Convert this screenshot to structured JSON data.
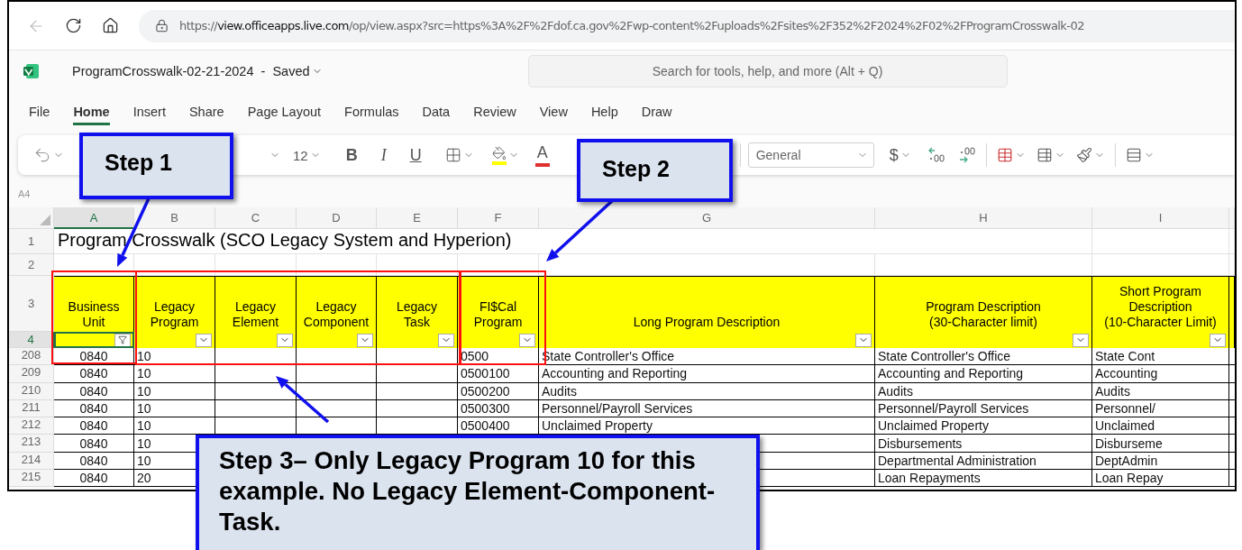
{
  "browser": {
    "url": "https://**view.officeapps.live.com**/op/view.aspx?src=https%3A%2F%2Fdof.ca.gov%2Fwp-content%2Fuploads%2Fsites%2F352%2F2024%2F02%2FProgramCrosswalk-02"
  },
  "app": {
    "document_title": "ProgramCrosswalk-02-21-2024  -  Saved",
    "search_placeholder": "Search for tools, help, and more (Alt + Q)"
  },
  "menu": [
    {
      "label": "File",
      "selected": false
    },
    {
      "label": "Home",
      "selected": true
    },
    {
      "label": "Insert",
      "selected": false
    },
    {
      "label": "Share",
      "selected": false
    },
    {
      "label": "Page Layout",
      "selected": false
    },
    {
      "label": "Formulas",
      "selected": false
    },
    {
      "label": "Data",
      "selected": false
    },
    {
      "label": "Review",
      "selected": false
    },
    {
      "label": "View",
      "selected": false
    },
    {
      "label": "Help",
      "selected": false
    },
    {
      "label": "Draw",
      "selected": false
    }
  ],
  "toolbar": {
    "font_size": "12",
    "format_buttons": [
      {
        "label": "B",
        "kind": "bold"
      },
      {
        "label": "I",
        "kind": "italic"
      },
      {
        "label": "U",
        "kind": "underline"
      }
    ],
    "font_color_label": "A",
    "number_format": "General",
    "currency_label": "$"
  },
  "name_box": "A4",
  "sheet": {
    "columns": [
      {
        "label": "A",
        "selected": true
      },
      {
        "label": "B",
        "selected": false
      },
      {
        "label": "C",
        "selected": false
      },
      {
        "label": "D",
        "selected": false
      },
      {
        "label": "E",
        "selected": false
      },
      {
        "label": "F",
        "selected": false
      },
      {
        "label": "G",
        "selected": false
      },
      {
        "label": "H",
        "selected": false
      },
      {
        "label": "I",
        "selected": false
      }
    ],
    "title_row": "1",
    "title": "Program Crosswalk (SCO Legacy System and Hyperion)",
    "blank_row": "2",
    "header_row": "3",
    "headers": [
      "Business\nUnit",
      "Legacy\nProgram",
      "Legacy\nElement",
      "Legacy\nComponent",
      "Legacy\nTask",
      "FI$Cal\nProgram",
      "Long Program Description",
      "Program Description\n(30-Character limit)",
      "Short Program\nDescription\n(10-Character Limit)"
    ],
    "filter_row": {
      "number": "4",
      "selected": true
    },
    "rows": [
      {
        "number": "208",
        "a": "0840",
        "b": "10",
        "f": "0500",
        "g": "State Controller's Office",
        "h": "State Controller's Office",
        "i": "State Cont"
      },
      {
        "number": "209",
        "a": "0840",
        "b": "10",
        "f": "0500100",
        "g": "Accounting and Reporting",
        "h": "Accounting and Reporting",
        "i": "Accounting"
      },
      {
        "number": "210",
        "a": "0840",
        "b": "10",
        "f": "0500200",
        "g": "Audits",
        "h": "Audits",
        "i": "Audits"
      },
      {
        "number": "211",
        "a": "0840",
        "b": "10",
        "f": "0500300",
        "g": "Personnel/Payroll Services",
        "h": "Personnel/Payroll Services",
        "i": "Personnel/"
      },
      {
        "number": "212",
        "a": "0840",
        "b": "10",
        "f": "0500400",
        "g": "Unclaimed Property",
        "h": "Unclaimed Property",
        "i": "Unclaimed"
      },
      {
        "number": "213",
        "a": "0840",
        "b": "10",
        "h": "Disbursements",
        "i": "Disburseme"
      },
      {
        "number": "214",
        "a": "0840",
        "b": "10",
        "h": "Departmental Administration",
        "i": "DeptAdmin"
      },
      {
        "number": "215",
        "a": "0840",
        "b": "20",
        "h": "Loan Repayments",
        "i": "Loan Repay"
      }
    ]
  },
  "callouts": [
    "Step 1",
    "Step 2",
    "Step 3– Only Legacy Program 10 for this example. No Legacy Element-Component-Task."
  ]
}
